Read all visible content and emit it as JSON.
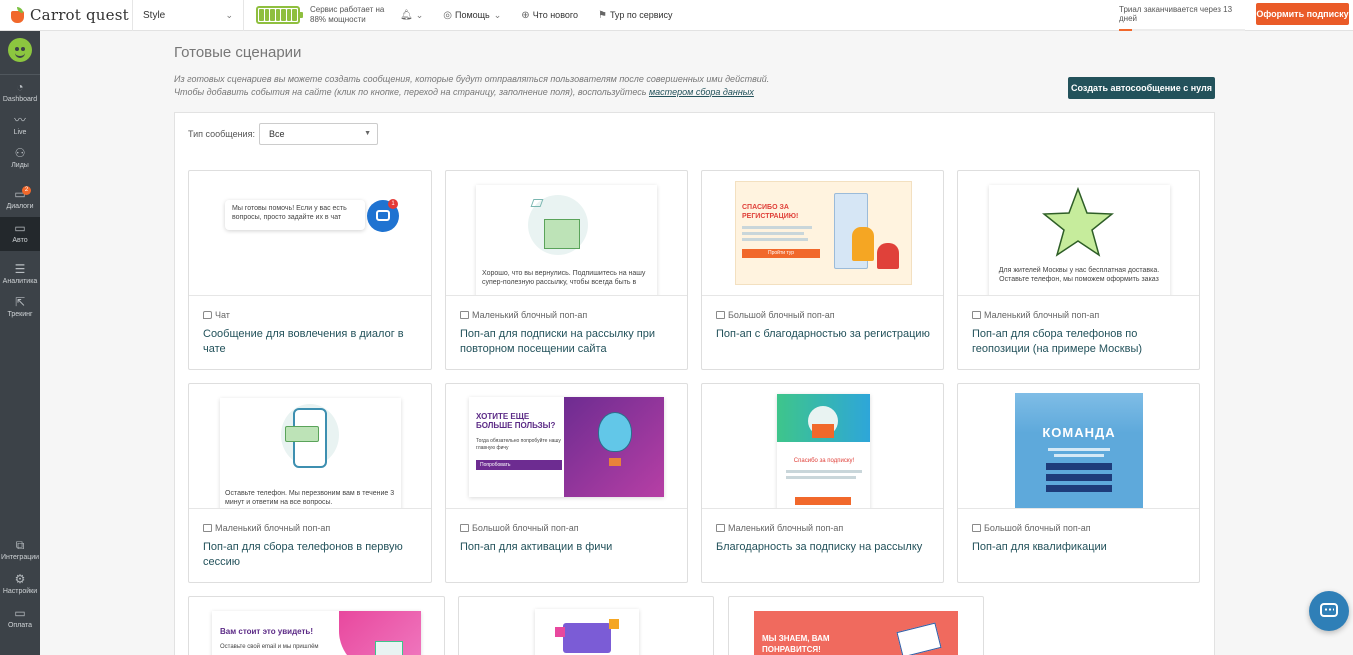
{
  "topbar": {
    "logo_text": "Carrot quest",
    "app_name": "Style",
    "status_line1": "Сервис работает на",
    "status_line2": "88% мощности",
    "battery_level_percent": 88,
    "help": "Помощь",
    "whats_new": "Что нового",
    "tour": "Тур по сервису",
    "trial_text": "Триал заканчивается через 13 дней",
    "trial_progress_fraction": 0.1,
    "subscribe_label": "Оформить подписку"
  },
  "sidebar": {
    "items": [
      {
        "label": "Dashboard",
        "icon": "gauge-icon"
      },
      {
        "label": "Live",
        "icon": "pulse-icon"
      },
      {
        "label": "Лиды",
        "icon": "users-icon"
      },
      {
        "label": "Диалоги",
        "icon": "chat-icon",
        "badge": "2"
      },
      {
        "label": "Авто",
        "icon": "auto-message-icon"
      },
      {
        "label": "Аналитика",
        "icon": "funnel-icon"
      },
      {
        "label": "Трекинг",
        "icon": "cursor-icon"
      },
      {
        "label": "Интеграции",
        "icon": "puzzle-icon"
      },
      {
        "label": "Настройки",
        "icon": "gear-icon"
      },
      {
        "label": "Оплата",
        "icon": "card-icon"
      }
    ]
  },
  "main": {
    "title": "Готовые сценарии",
    "desc_line1": "Из готовых сценариев вы можете создать сообщения, которые будут отправляться пользователям после совершенных ими действий.",
    "desc_line2": "Чтобы добавить события на сайте (клик по кнопке, переход на страницу, заполнение поля), воспользуйтесь",
    "desc_link": "мастером сбора данных",
    "create_button": "Создать автосообщение с нуля",
    "filter_label": "Тип сообщения:",
    "filter_value": "Все"
  },
  "cards": [
    {
      "type": "Чат",
      "title": "Сообщение для вовлечения в диалог в чате",
      "preview_text": "Мы готовы помочь! Если у вас есть вопросы, просто задайте их в чат",
      "badge": "1"
    },
    {
      "type": "Маленький блочный поп-ап",
      "title": "Поп-ап для подписки на рассылку при повторном посещении сайта",
      "preview_text": "Хорошо, что вы вернулись. Подпишитесь на нашу супер-полезную рассылку, чтобы всегда быть в"
    },
    {
      "type": "Большой блочный поп-ап",
      "title": "Поп-ап с благодарностью за регистрацию",
      "preview_heading": "СПАСИБО ЗА РЕГИСТРАЦИЮ!",
      "preview_button": "Пройти тур"
    },
    {
      "type": "Маленький блочный поп-ап",
      "title": "Поп-ап для сбора телефонов по геопозиции (на примере Москвы)",
      "preview_text": "Для жителей Москвы у нас бесплатная доставка. Оставьте телефон, мы поможем оформить заказ"
    },
    {
      "type": "Маленький блочный поп-ап",
      "title": "Поп-ап для сбора телефонов в первую сессию",
      "preview_text": "Оставьте телефон. Мы перезвоним вам в течение 3 минут и ответим на все вопросы."
    },
    {
      "type": "Большой блочный поп-ап",
      "title": "Поп-ап для активации в фичи",
      "preview_heading": "ХОТИТЕ ЕЩЕ БОЛЬШЕ ПОЛЬЗЫ?",
      "preview_text": "Тогда обязательно попробуйте нашу главную фичу",
      "preview_button": "Попробовать"
    },
    {
      "type": "Маленький блочный поп-ап",
      "title": "Благодарность за подписку на рассылку",
      "preview_heading": "Спасибо за подписку!"
    },
    {
      "type": "Большой блочный поп-ап",
      "title": "Поп-ап для квалификации",
      "preview_heading": "КОМАНДА"
    },
    {
      "preview_heading": "Вам стоит это увидеть!",
      "preview_text": "Оставьте свой email и мы пришлём"
    },
    {},
    {
      "preview_heading": "МЫ ЗНАЕМ, ВАМ ПОНРАВИТСЯ!"
    }
  ],
  "colors": {
    "brand_orange": "#ea5b28",
    "accent_teal": "#23525b",
    "sidebar_bg": "#3c4248",
    "battery_green": "#8fbf3f"
  }
}
